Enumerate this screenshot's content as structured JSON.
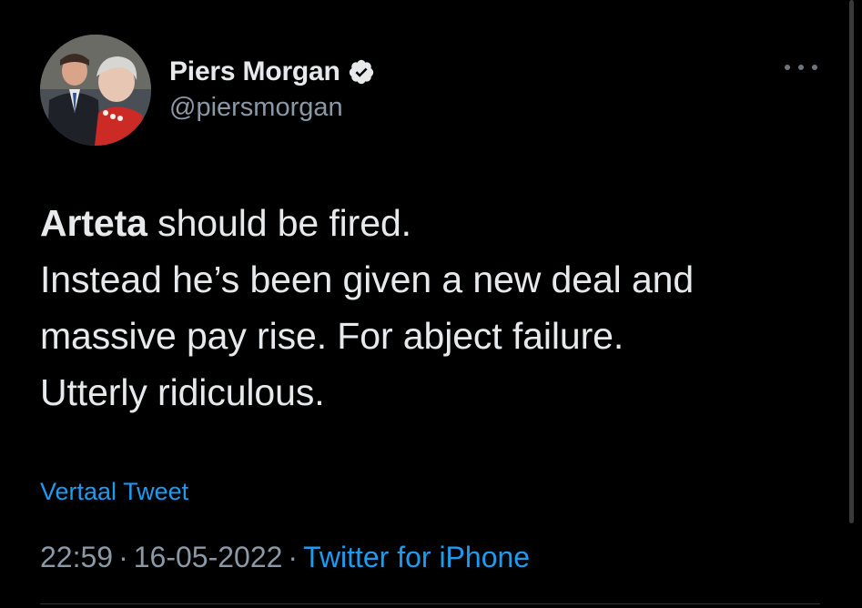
{
  "tweet": {
    "author": {
      "display_name": "Piers Morgan",
      "handle": "@piersmorgan",
      "verified_icon": "verified-badge-icon",
      "avatar": "profile-photo"
    },
    "more_icon": "more-options-icon",
    "text": {
      "line1_bold": "Arteta",
      "line1_rest": " should be fired.",
      "line2": "Instead he’s been given a new deal and",
      "line3": "massive pay rise. For abject failure.",
      "line4": "Utterly ridiculous."
    },
    "translate_label": "Vertaal Tweet",
    "meta": {
      "time": "22:59",
      "separator": "·",
      "date": "16-05-2022",
      "source": "Twitter for iPhone"
    }
  },
  "colors": {
    "background": "#000000",
    "text": "#e7e9ea",
    "secondary": "#8b98a5",
    "accent": "#1d9bf0"
  }
}
